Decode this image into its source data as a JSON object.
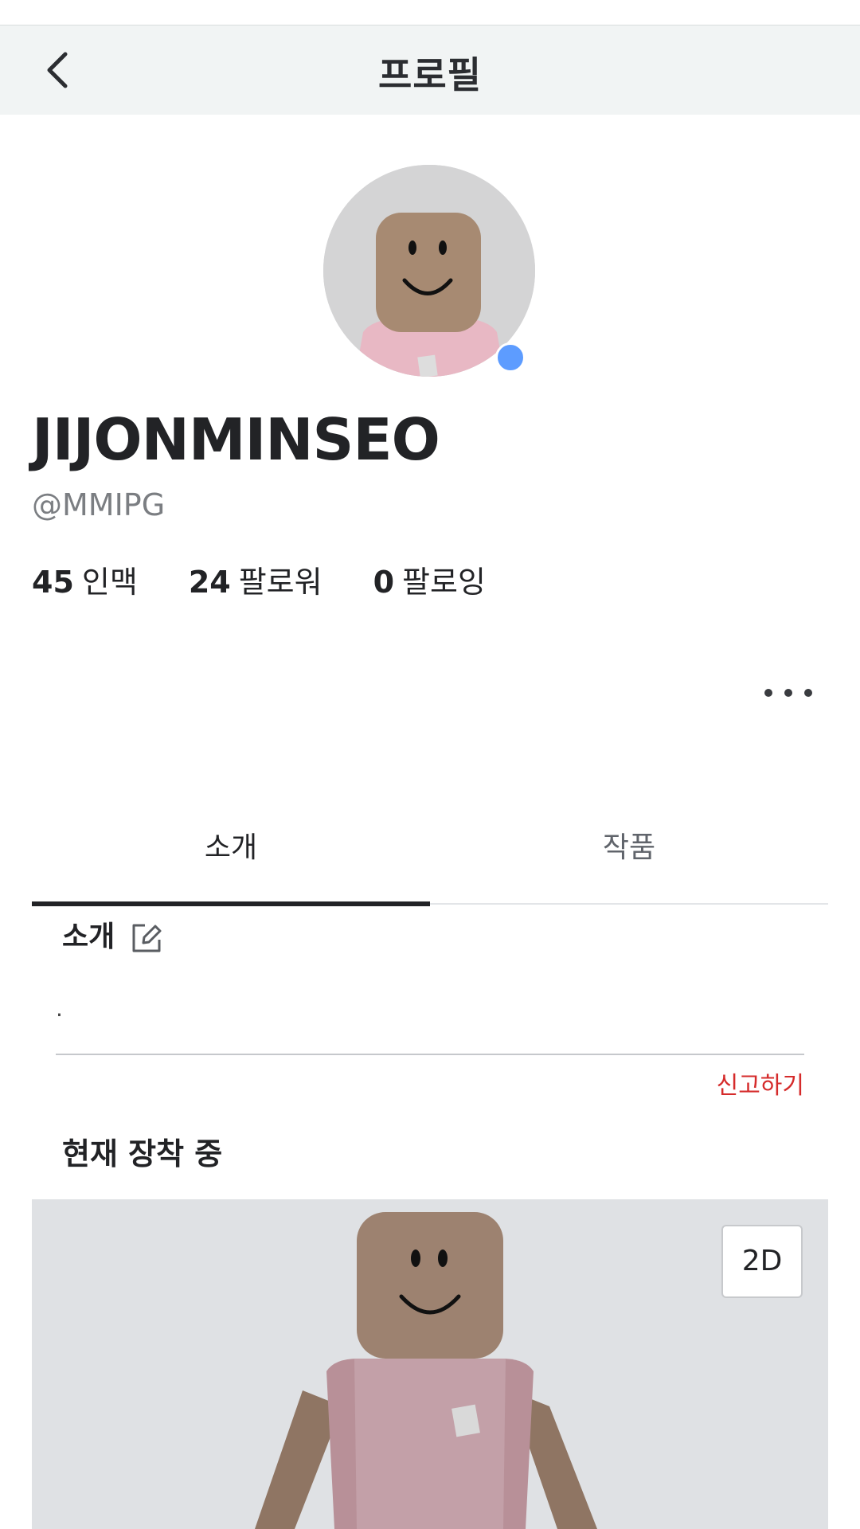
{
  "header": {
    "title": "프로필",
    "back_icon": "chevron-left-icon"
  },
  "profile": {
    "display_name": "JIJONMINSEO",
    "username": "@MMIPG",
    "online_status_color": "#5d9cff"
  },
  "stats": [
    {
      "count": "45",
      "label": "인맥"
    },
    {
      "count": "24",
      "label": "팔로워"
    },
    {
      "count": "0",
      "label": "팔로잉"
    }
  ],
  "more_icon": "more-horizontal-icon",
  "tabs": [
    {
      "label": "소개",
      "active": true
    },
    {
      "label": "작품",
      "active": false
    }
  ],
  "about": {
    "title": "소개",
    "edit_icon": "edit-icon",
    "text": ".",
    "report_label": "신고하기"
  },
  "currently_wearing": {
    "title": "현재 장착 중",
    "view_toggle_label": "2D"
  },
  "colors": {
    "header_bg": "#f1f4f4",
    "report": "#d52b2b",
    "accent_dark": "#222326",
    "viewer_bg": "#dfe1e4"
  }
}
